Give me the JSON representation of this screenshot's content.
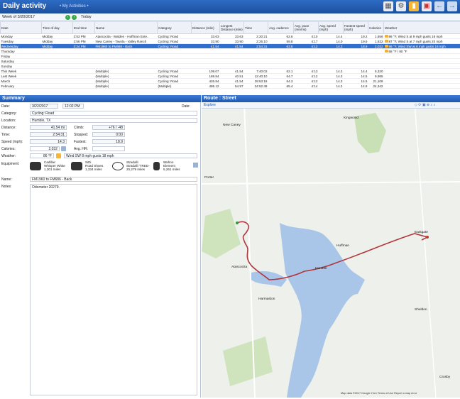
{
  "header": {
    "title": "Daily activity",
    "crumb": "• My Activities •"
  },
  "week": {
    "label": "Week of 3/20/2017",
    "today": "Today"
  },
  "table": {
    "columns": [
      "Date",
      "Time of day",
      "End time",
      "Name",
      "Category",
      "Distance (mile)",
      "Longest Distance (mile)",
      "Time",
      "Avg. cadence",
      "Avg. pace (min/mi)",
      "Avg. speed (mph)",
      "Fastest speed (mph)",
      "Calories",
      "Weather"
    ],
    "rows": [
      [
        "Monday",
        "Midday",
        "2:53 PM",
        "Atascocita - Walden - Huffman Exte..",
        "Cycling: Road",
        "33.63",
        "33.63",
        "2:20:21",
        "62.6",
        "4:10",
        "14.4",
        "19.2",
        "1,656",
        "86 °F, Wind S at 9 mph gusts 18 mph"
      ],
      [
        "Tuesday",
        "Midday",
        "3:56 PM",
        "New Caney - Tavola - Valley Ranch",
        "Cycling: Road",
        "33.90",
        "33.90",
        "2:25:10",
        "59.8",
        "4:17",
        "14.0",
        "19.6",
        "1,632",
        "87 °F, Wind S at 7 mph gusts 20 mph"
      ],
      [
        "Wednesday",
        "Midday",
        "3:24 PM",
        "FM1960 to FM686 - Back",
        "Cycling: Road",
        "41.54",
        "41.54",
        "2:54:31",
        "63.5",
        "4:12",
        "14.3",
        "18.9",
        "2,032",
        "86 °F, Wind SW at 8 mph gusts 18 mph"
      ],
      [
        "Thursday",
        "",
        "",
        "",
        "",
        "",
        "",
        "",
        "",
        "",
        "",
        "",
        "",
        "68 °F / 80 °F"
      ],
      [
        "Friday",
        "",
        "",
        "",
        "",
        "",
        "",
        "",
        "",
        "",
        "",
        "",
        "",
        ""
      ],
      [
        "Saturday",
        "",
        "",
        "",
        "",
        "",
        "",
        "",
        "",
        "",
        "",
        "",
        "",
        ""
      ],
      [
        "Sunday",
        "",
        "",
        "",
        "",
        "",
        "",
        "",
        "",
        "",
        "",
        "",
        "",
        ""
      ],
      [
        "This Week",
        "",
        "",
        "(Multiple)",
        "Cycling: Road",
        "109.07",
        "41.54",
        "7:40:02",
        "62.1",
        "4:13",
        "14.2",
        "14.4",
        "5,320",
        ""
      ],
      [
        "Last Week",
        "",
        "",
        "(Multiple)",
        "Cycling: Road",
        "189.84",
        "40.51",
        "12:40:10",
        "64.7",
        "4:12",
        "14.3",
        "14.5",
        "9,985",
        ""
      ],
      [
        "March",
        "",
        "",
        "(Multiple)",
        "Cycling: Road",
        "426.84",
        "41.54",
        "29:53:18",
        "64.3",
        "4:12",
        "14.3",
        "14.5",
        "21,109",
        ""
      ],
      [
        "February",
        "",
        "",
        "(Multiple)",
        "(Multiple)",
        "495.12",
        "54.97",
        "34:52:49",
        "65.4",
        "4:14",
        "14.2",
        "14.9",
        "24,342",
        ""
      ]
    ],
    "selected_row": 2
  },
  "summary": {
    "title": "Summary",
    "date_label": "Date:",
    "date": "3/22/2017",
    "time": "12:02 PM",
    "date_right": "Date:",
    "category_label": "Category:",
    "category": "Cycling: Road",
    "location_label": "Location:",
    "location": "Humble, TX",
    "distance_label": "Distance:",
    "distance": "41.54 mi",
    "climb_label": "Climb:",
    "climb": "+76 / -48",
    "time_label": "Time:",
    "time_val": "2:54:31",
    "stopped_label": "Stopped:",
    "stopped": "0:00",
    "speed_label": "Speed (mph):",
    "speed": "14.3",
    "fastest_label": "Fastest:",
    "fastest": "18.9",
    "calories_label": "Calories:",
    "calories": "2,032",
    "avghr_label": "Avg. HR:",
    "weather_label": "Weather:",
    "temp": "86 °F",
    "weather": "Wind SW 8 mph gusts 18 mph",
    "equipment_label": "Equipment:",
    "equipment": [
      {
        "l1": "Cadillac",
        "l2": "Whisper White",
        "l3": "1,301 miles"
      },
      {
        "l1": "SiDi",
        "l2": "Road Shoes",
        "l3": "1,334 miles"
      },
      {
        "l1": "Stradalli",
        "l2": "Stradalli 'TRED-",
        "l3": "20,279 miles"
      },
      {
        "l1": "Wahoo",
        "l2": "Element",
        "l3": "5,261 miles"
      }
    ],
    "name_label": "Name:",
    "name": "FM1960 to FM686 - Back",
    "notes_label": "Notes:",
    "notes": "Odometer 20279."
  },
  "map": {
    "title": "Route : Street",
    "explore": "Explore",
    "places": [
      "New Caney",
      "Porter",
      "Atascocita",
      "Humble",
      "Huffman",
      "Eastgate",
      "Crosby",
      "Kingwood",
      "Harmaston",
      "Sheldon"
    ],
    "footer": "Map data ©2017 Google   2 km   Terms of Use   Report a map error"
  },
  "colors": {
    "title": "#1d4f9e",
    "selected": "#2f6fd0",
    "route": "#b0363f",
    "water": "#a9c6e8"
  }
}
